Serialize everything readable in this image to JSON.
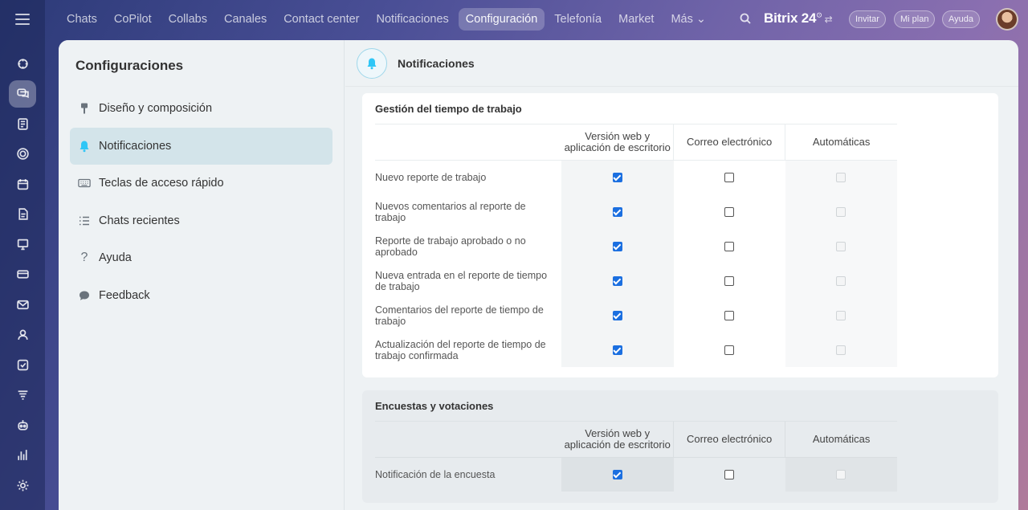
{
  "topnav": {
    "items": [
      {
        "label": "Chats"
      },
      {
        "label": "CoPilot"
      },
      {
        "label": "Collabs"
      },
      {
        "label": "Canales"
      },
      {
        "label": "Contact center"
      },
      {
        "label": "Notificaciones"
      },
      {
        "label": "Configuración",
        "active": true
      },
      {
        "label": "Telefonía"
      },
      {
        "label": "Market"
      },
      {
        "label": "Más ⌄"
      }
    ],
    "brand": "Bitrix 24",
    "brand_badge": "⊙",
    "brand_switch": "⇄",
    "invite": "Invitar",
    "plan": "Mi plan",
    "help": "Ayuda"
  },
  "sidebar": {
    "title": "Configuraciones",
    "items": [
      {
        "label": "Diseño y composición",
        "icon": "brush-icon"
      },
      {
        "label": "Notificaciones",
        "icon": "bell-icon",
        "active": true
      },
      {
        "label": "Teclas de acceso rápido",
        "icon": "keyboard-icon"
      },
      {
        "label": "Chats recientes",
        "icon": "list-icon"
      },
      {
        "label": "Ayuda",
        "icon": "question-icon"
      },
      {
        "label": "Feedback",
        "icon": "chat-bubble-icon"
      }
    ]
  },
  "content": {
    "header_title": "Notificaciones"
  },
  "columns": {
    "web": "Versión web y aplicación de escritorio",
    "email": "Correo electrónico",
    "auto": "Automáticas"
  },
  "sections": [
    {
      "title": "Gestión del tiempo de trabajo",
      "rows": [
        {
          "label": "Nuevo reporte de trabajo",
          "web": true,
          "email": false,
          "auto": false
        },
        {
          "label": "Nuevos comentarios al reporte de trabajo",
          "web": true,
          "email": false,
          "auto": false
        },
        {
          "label": "Reporte de trabajo aprobado o no aprobado",
          "web": true,
          "email": false,
          "auto": false
        },
        {
          "label": "Nueva entrada en el reporte de tiempo de trabajo",
          "web": true,
          "email": false,
          "auto": false
        },
        {
          "label": "Comentarios del reporte de tiempo de trabajo",
          "web": true,
          "email": false,
          "auto": false
        },
        {
          "label": "Actualización del reporte de tiempo de trabajo confirmada",
          "web": true,
          "email": false,
          "auto": false
        }
      ]
    },
    {
      "title": "Encuestas y votaciones",
      "rows": [
        {
          "label": "Notificación de la encuesta",
          "web": true,
          "email": false,
          "auto": false
        }
      ]
    }
  ]
}
